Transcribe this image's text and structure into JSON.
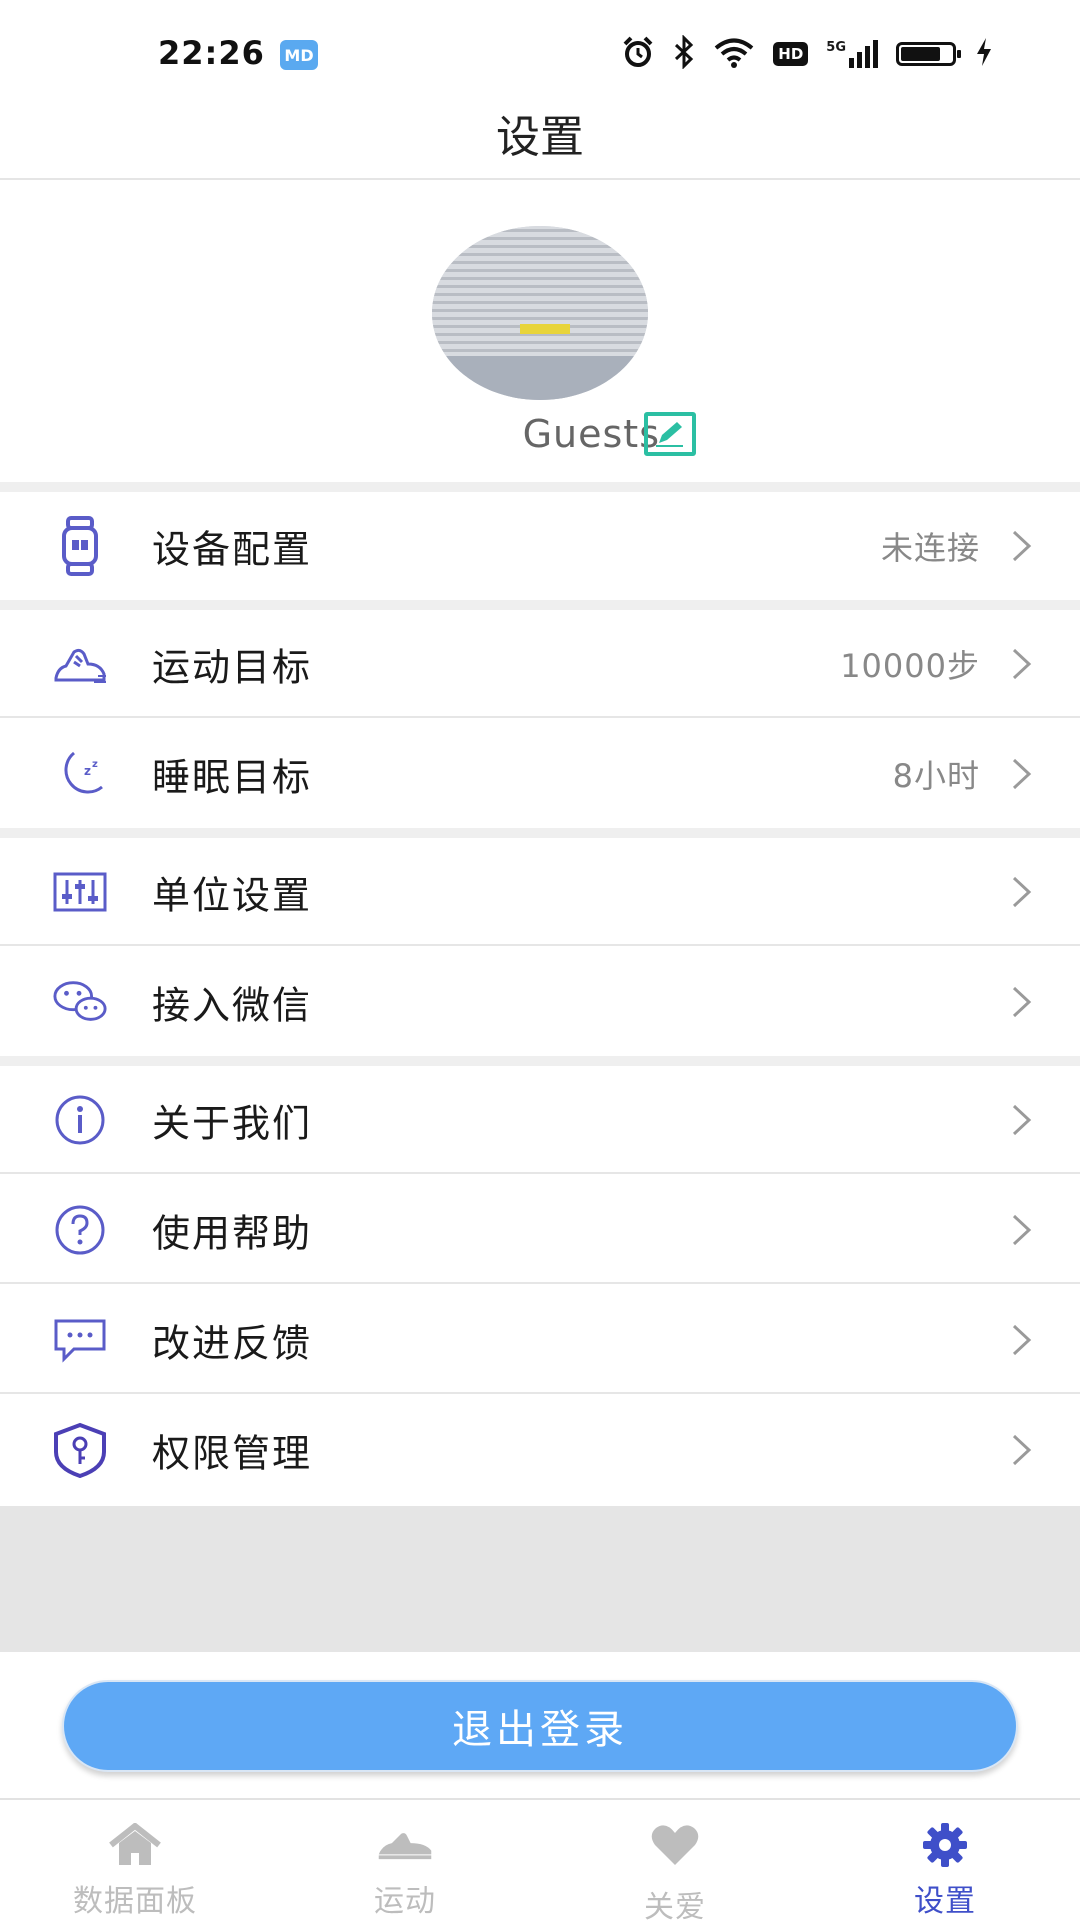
{
  "status_bar": {
    "time": "22:26",
    "app_badge": "MD",
    "hd_label": "HD",
    "network_label": "5G"
  },
  "header": {
    "title": "设置"
  },
  "profile": {
    "username": "Guests"
  },
  "settings_groups": [
    {
      "items": [
        {
          "label": "设备配置",
          "value": "未连接",
          "icon": "watch-icon"
        }
      ]
    },
    {
      "items": [
        {
          "label": "运动目标",
          "value": "10000步",
          "icon": "running-shoe-icon"
        },
        {
          "label": "睡眠目标",
          "value": "8小时",
          "icon": "moon-sleep-icon"
        }
      ]
    },
    {
      "items": [
        {
          "label": "单位设置",
          "value": "",
          "icon": "sliders-icon"
        },
        {
          "label": "接入微信",
          "value": "",
          "icon": "wechat-icon"
        }
      ]
    },
    {
      "items": [
        {
          "label": "关于我们",
          "value": "",
          "icon": "info-icon"
        },
        {
          "label": "使用帮助",
          "value": "",
          "icon": "help-icon"
        },
        {
          "label": "改进反馈",
          "value": "",
          "icon": "feedback-icon"
        },
        {
          "label": "权限管理",
          "value": "",
          "icon": "shield-key-icon"
        }
      ]
    }
  ],
  "logout_label": "退出登录",
  "tabs": [
    {
      "label": "数据面板",
      "icon": "home-icon",
      "active": false
    },
    {
      "label": "运动",
      "icon": "shoe-icon",
      "active": false
    },
    {
      "label": "关爱",
      "icon": "heart-icon",
      "active": false
    },
    {
      "label": "设置",
      "icon": "gear-icon",
      "active": true
    }
  ],
  "colors": {
    "accent": "#5a5cc8",
    "logout_button": "#5ea8f5",
    "active_tab": "#3f4fc9",
    "inactive_tab": "#bdbdbd",
    "edit_icon": "#2bbfa3"
  }
}
